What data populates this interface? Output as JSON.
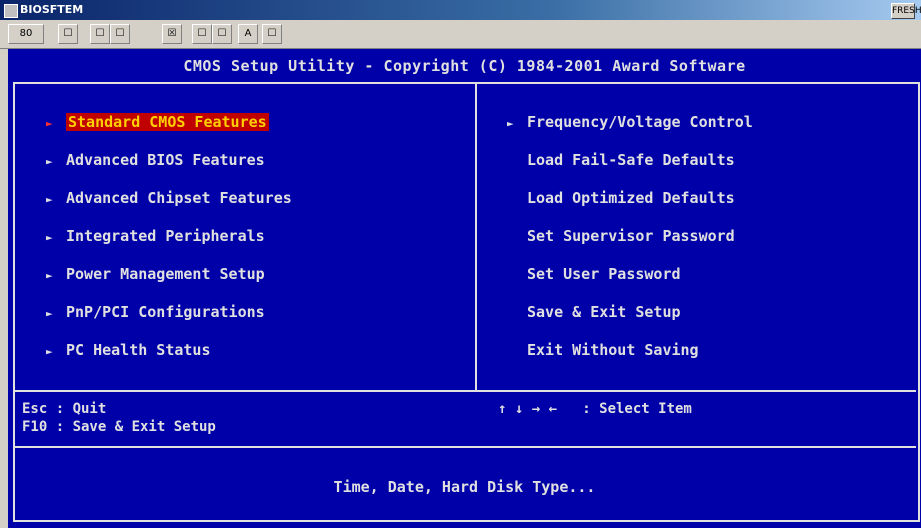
{
  "window": {
    "title": "BIOSFTEM",
    "controls_label": "FRESH"
  },
  "toolbar": {
    "buttons": [
      "80",
      "☐",
      "☐",
      "☐",
      "☒",
      "☐",
      "☐",
      "A",
      "☐"
    ]
  },
  "header": {
    "title": "CMOS Setup Utility - Copyright (C) 1984-2001 Award Software"
  },
  "menu": {
    "left": [
      {
        "label": "Standard CMOS Features",
        "arrow": "►",
        "selected": true
      },
      {
        "label": "Advanced BIOS Features",
        "arrow": "►"
      },
      {
        "label": "Advanced Chipset Features",
        "arrow": "►"
      },
      {
        "label": "Integrated Peripherals",
        "arrow": "►"
      },
      {
        "label": "Power Management Setup",
        "arrow": "►"
      },
      {
        "label": "PnP/PCI Configurations",
        "arrow": "►"
      },
      {
        "label": "PC Health Status",
        "arrow": "►"
      }
    ],
    "right": [
      {
        "label": "Frequency/Voltage Control",
        "arrow": "►"
      },
      {
        "label": "Load Fail-Safe Defaults",
        "arrow": ""
      },
      {
        "label": "Load Optimized Defaults",
        "arrow": ""
      },
      {
        "label": "Set Supervisor Password",
        "arrow": ""
      },
      {
        "label": "Set User Password",
        "arrow": ""
      },
      {
        "label": "Save & Exit Setup",
        "arrow": ""
      },
      {
        "label": "Exit Without Saving",
        "arrow": ""
      }
    ]
  },
  "help": {
    "esc": "Esc : Quit",
    "f10": "F10 : Save & Exit Setup",
    "arrows": "↑ ↓ → ←   : Select Item"
  },
  "description": "Time, Date, Hard Disk Type...",
  "colors": {
    "bios_bg": "#0000a8",
    "fg": "#e0e0e0",
    "highlight_bg": "#c00000",
    "highlight_fg": "#ffd000"
  }
}
